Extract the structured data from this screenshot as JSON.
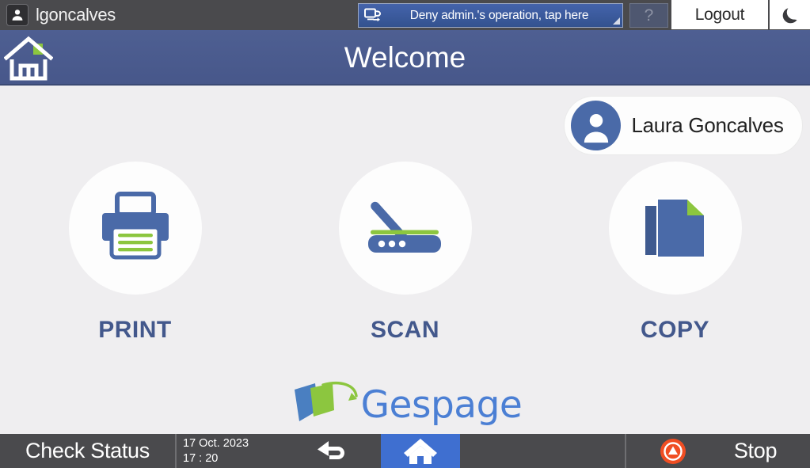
{
  "topbar": {
    "user_icon": "person-icon",
    "username": "lgoncalves",
    "notification": {
      "icon": "print-redirect-icon",
      "text": "Deny admin.'s operation, tap here",
      "resize_corner": "resize-corner-icon"
    },
    "help_label": "?",
    "logout_label": "Logout",
    "sleep_icon": "moon-icon"
  },
  "titlebar": {
    "home_icon": "home-outline-icon",
    "title": "Welcome"
  },
  "main": {
    "user_chip": {
      "avatar_icon": "user-avatar-icon",
      "name": "Laura Goncalves"
    },
    "tiles": [
      {
        "icon": "printer-icon",
        "label": "PRINT"
      },
      {
        "icon": "scanner-icon",
        "label": "SCAN"
      },
      {
        "icon": "copy-documents-icon",
        "label": "COPY"
      }
    ],
    "brand": {
      "mark_icon": "gespage-logo-icon",
      "text": "Gespage"
    }
  },
  "bottombar": {
    "check_status_label": "Check Status",
    "date": "17 Oct. 2023",
    "time": "17 : 20",
    "back_icon": "back-arrow-icon",
    "home_icon": "home-filled-icon",
    "stop_icon": "stop-circle-icon",
    "stop_label": "Stop"
  },
  "colors": {
    "topbar_bg": "#4a4a4d",
    "titlebar_bg": "#4b5c8d",
    "content_bg": "#efeef0",
    "accent_blue": "#43588c",
    "notify_blue": "#3b5998",
    "home_btn_blue": "#3f6fd0",
    "icon_blue": "#4a6aa8",
    "icon_green": "#8cc63f",
    "stop_orange": "#f04e23",
    "brand_blue": "#4b7fd4"
  }
}
